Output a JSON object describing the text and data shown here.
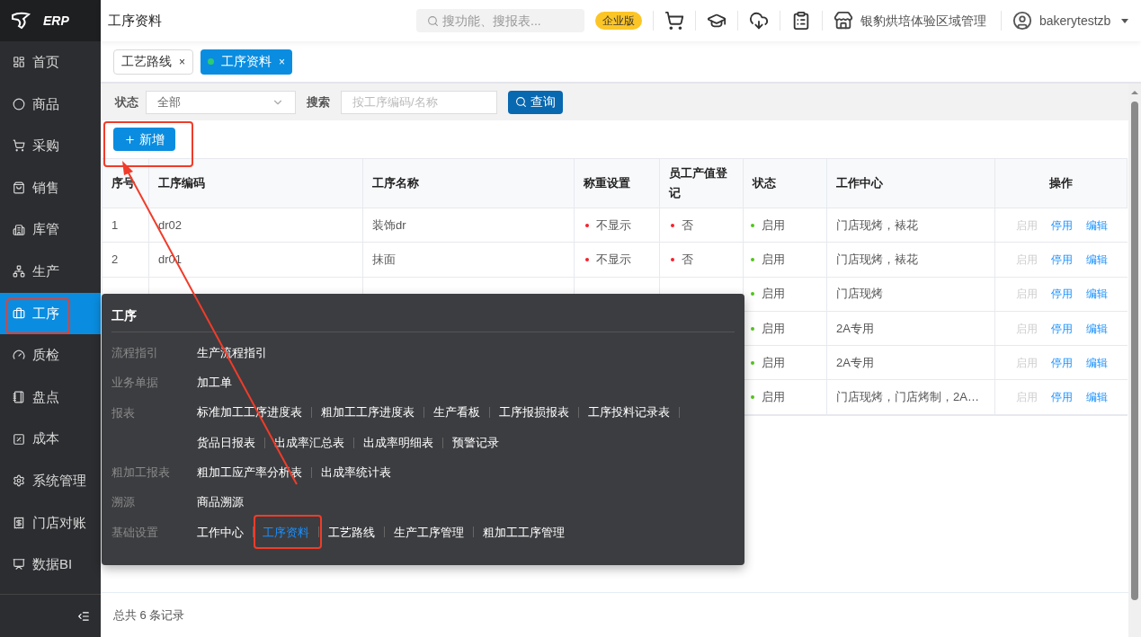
{
  "logo": {
    "text": "ERP"
  },
  "sidebar": {
    "items": [
      {
        "label": "首页",
        "selected": false
      },
      {
        "label": "商品",
        "selected": false
      },
      {
        "label": "采购",
        "selected": false
      },
      {
        "label": "销售",
        "selected": false
      },
      {
        "label": "库管",
        "selected": false
      },
      {
        "label": "生产",
        "selected": false
      },
      {
        "label": "工序",
        "selected": true
      },
      {
        "label": "质检",
        "selected": false
      },
      {
        "label": "盘点",
        "selected": false
      },
      {
        "label": "成本",
        "selected": false
      },
      {
        "label": "系统管理",
        "selected": false
      },
      {
        "label": "门店对账",
        "selected": false
      },
      {
        "label": "数据BI",
        "selected": false
      }
    ]
  },
  "header": {
    "title": "工序资料",
    "search_placeholder": "搜功能、搜报表...",
    "edition_badge": "企业版",
    "store": "银豹烘培体验区域管理",
    "user": "bakerytestzb"
  },
  "tabs": [
    {
      "label": "工艺路线",
      "selected": false,
      "close": "×"
    },
    {
      "label": "工序资料",
      "selected": true,
      "close": "×"
    }
  ],
  "filters": {
    "status_label": "状态",
    "status_value": "全部",
    "search_label": "搜索",
    "search_placeholder": "按工序编码/名称",
    "query_button": "查询"
  },
  "add_button": "新增",
  "table": {
    "columns": [
      "序号",
      "工序编码",
      "工序名称",
      "称重设置",
      "员工产值登记",
      "状态",
      "工作中心",
      "操作"
    ],
    "rows": [
      {
        "index": "1",
        "code": "dr02",
        "name": "装饰dr",
        "weigh": {
          "text": "不显示",
          "color": "#f5222d"
        },
        "staff": {
          "text": "否",
          "color": "#f5222d"
        },
        "status": {
          "text": "启用",
          "color": "#52c41a"
        },
        "center": "门店现烤，裱花",
        "actions": [
          {
            "label": "启用",
            "disabled": true
          },
          {
            "label": "停用",
            "disabled": false
          },
          {
            "label": "编辑",
            "disabled": false
          }
        ]
      },
      {
        "index": "2",
        "code": "dr01",
        "name": "抹面",
        "weigh": {
          "text": "不显示",
          "color": "#f5222d"
        },
        "staff": {
          "text": "否",
          "color": "#f5222d"
        },
        "status": {
          "text": "启用",
          "color": "#52c41a"
        },
        "center": "门店现烤，裱花",
        "actions": [
          {
            "label": "启用",
            "disabled": true
          },
          {
            "label": "停用",
            "disabled": false
          },
          {
            "label": "编辑",
            "disabled": false
          }
        ]
      },
      {
        "status": {
          "text": "启用",
          "color": "#52c41a"
        },
        "center": "门店现烤",
        "actions": [
          {
            "label": "启用",
            "disabled": true
          },
          {
            "label": "停用",
            "disabled": false
          },
          {
            "label": "编辑",
            "disabled": false
          }
        ]
      },
      {
        "status": {
          "text": "启用",
          "color": "#52c41a"
        },
        "center": "2A专用",
        "actions": [
          {
            "label": "启用",
            "disabled": true
          },
          {
            "label": "停用",
            "disabled": false
          },
          {
            "label": "编辑",
            "disabled": false
          }
        ]
      },
      {
        "status": {
          "text": "启用",
          "color": "#52c41a"
        },
        "center": "2A专用",
        "actions": [
          {
            "label": "启用",
            "disabled": true
          },
          {
            "label": "停用",
            "disabled": false
          },
          {
            "label": "编辑",
            "disabled": false
          }
        ]
      },
      {
        "status": {
          "text": "启用",
          "color": "#52c41a"
        },
        "center": "门店现烤，门店烤制，2A…",
        "actions": [
          {
            "label": "启用",
            "disabled": true
          },
          {
            "label": "停用",
            "disabled": false
          },
          {
            "label": "编辑",
            "disabled": false
          }
        ]
      }
    ]
  },
  "footer": "总共 6 条记录",
  "popup_menu": {
    "title": "工序",
    "sections": [
      {
        "label": "流程指引",
        "lines": [
          [
            {
              "label": "生产流程指引",
              "selected": false
            }
          ]
        ]
      },
      {
        "label": "业务单据",
        "lines": [
          [
            {
              "label": "加工单",
              "selected": false
            }
          ]
        ]
      },
      {
        "label": "报表",
        "lines": [
          [
            {
              "label": "标准加工工序进度表",
              "selected": false
            },
            {
              "label": "粗加工工序进度表",
              "selected": false
            },
            {
              "label": "生产看板",
              "selected": false
            },
            {
              "label": "工序报损报表",
              "selected": false
            },
            {
              "label": "工序投料记录表",
              "selected": false
            }
          ],
          [
            {
              "label": "货品日报表",
              "selected": false
            },
            {
              "label": "出成率汇总表",
              "selected": false
            },
            {
              "label": "出成率明细表",
              "selected": false
            },
            {
              "label": "预警记录",
              "selected": false
            }
          ]
        ]
      },
      {
        "label": "粗加工报表",
        "lines": [
          [
            {
              "label": "粗加工应产率分析表",
              "selected": false
            },
            {
              "label": "出成率统计表",
              "selected": false
            }
          ]
        ]
      },
      {
        "label": "溯源",
        "lines": [
          [
            {
              "label": "商品溯源",
              "selected": false
            }
          ]
        ]
      },
      {
        "label": "基础设置",
        "lines": [
          [
            {
              "label": "工作中心",
              "selected": false
            },
            {
              "label": "工序资料",
              "selected": true
            },
            {
              "label": "工艺路线",
              "selected": false
            },
            {
              "label": "生产工序管理",
              "selected": false
            },
            {
              "label": "粗加工工序管理",
              "selected": false
            }
          ]
        ]
      }
    ]
  }
}
